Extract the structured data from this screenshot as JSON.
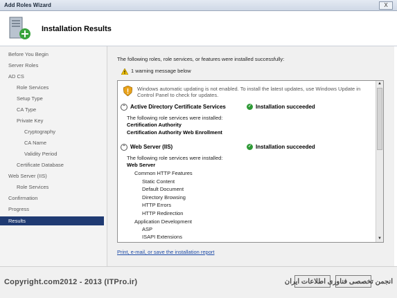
{
  "window": {
    "title": "Add Roles Wizard",
    "close_label": "X"
  },
  "header": {
    "title": "Installation Results",
    "icon": "server-add-icon"
  },
  "sidebar": {
    "items": [
      {
        "label": "Before You Begin"
      },
      {
        "label": "Server Roles"
      },
      {
        "label": "AD CS"
      },
      {
        "label": "Role Services"
      },
      {
        "label": "Setup Type"
      },
      {
        "label": "CA Type"
      },
      {
        "label": "Private Key"
      },
      {
        "label": "Cryptography"
      },
      {
        "label": "CA Name"
      },
      {
        "label": "Validity Period"
      },
      {
        "label": "Certificate Database"
      },
      {
        "label": "Web Server (IIS)"
      },
      {
        "label": "Role Services"
      },
      {
        "label": "Confirmation"
      },
      {
        "label": "Progress"
      },
      {
        "label": "Results",
        "selected": true
      }
    ]
  },
  "main": {
    "intro": "The following roles, role services, or features were installed successfully:",
    "warning_count": "1 warning message below",
    "warning_text_1": "Windows automatic updating is not enabled. To install the latest updates, use Windows Update in",
    "warning_text_2": "Control Panel to check for updates.",
    "sections": [
      {
        "name": "Active Directory Certificate Services",
        "status": "Installation succeeded",
        "intro": "The following role services were installed:",
        "services": [
          "Certification Authority",
          "Certification Authority Web Enrollment"
        ]
      },
      {
        "name": "Web Server (IIS)",
        "status": "Installation succeeded",
        "intro": "The following role services were installed:",
        "root": "Web Server",
        "group1": "Common HTTP Features",
        "group1_items": [
          "Static Content",
          "Default Document",
          "Directory Browsing",
          "HTTP Errors",
          "HTTP Redirection"
        ],
        "group2": "Application Development",
        "group2_items": [
          "ASP",
          "ISAPI Extensions"
        ]
      }
    ],
    "link": "Print, e-mail, or save the installation report"
  },
  "footer": {
    "copyright": "Copyright.com2012 - 2013 (ITPro.ir)",
    "persian": "انجمن تخصصی فناوری اطلاعات ایران"
  },
  "colors": {
    "selected_nav": "#1f3a72",
    "link": "#1b49a6",
    "success": "#2e9a36",
    "warning": "#f2c200"
  }
}
